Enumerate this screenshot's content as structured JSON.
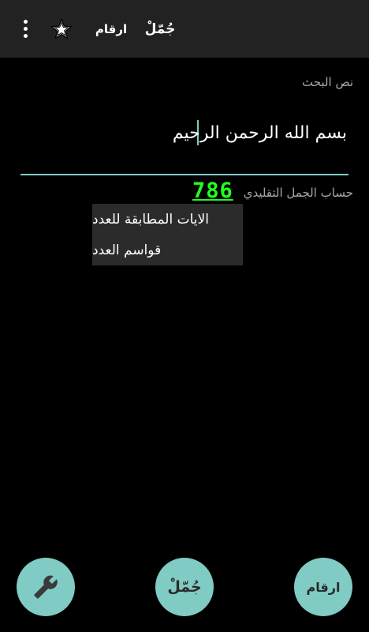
{
  "toolbar": {
    "overflow_icon": "more-vert-icon",
    "favorite_icon": "star-icon",
    "arqam_label": "ارقام",
    "jummal_label": "جُمّلْ"
  },
  "search": {
    "label": "نص البحث",
    "value": "بسم الله الرحمن الرحيم"
  },
  "result": {
    "label": "حساب الجمل التقليدي",
    "value": "786",
    "value_color": "#22ff22"
  },
  "popup_menu": {
    "items": [
      {
        "label": "الايات المطابقة للعدد"
      },
      {
        "label": "قواسم العدد"
      }
    ]
  },
  "fabs": {
    "settings_icon": "wrench-icon",
    "jummal_label": "جُمّلْ",
    "arqam_label": "ارقام"
  },
  "colors": {
    "appbar": "#222222",
    "accent": "#80cbc4",
    "background": "#000000",
    "menu": "#2b2b2b"
  }
}
